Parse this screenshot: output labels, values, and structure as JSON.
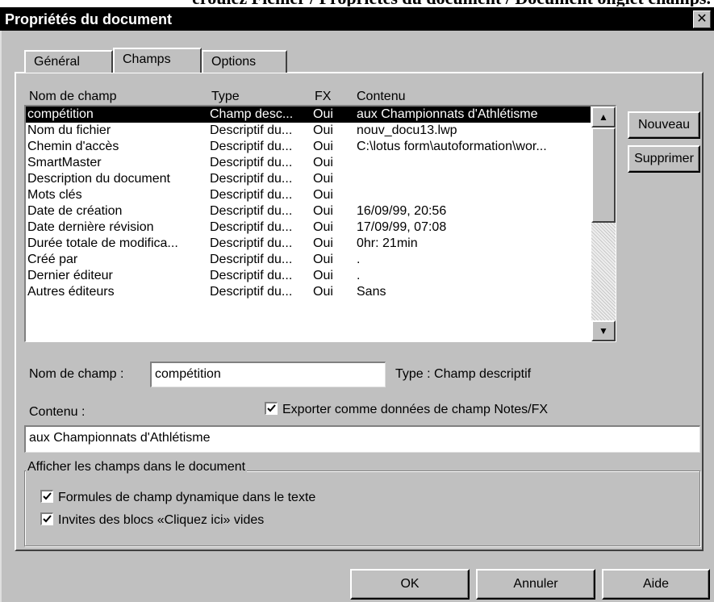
{
  "caption": "eroulez Fichier / Propriétés du document / Document onglet champs.",
  "dialog": {
    "title": "Propriétés du document",
    "close_glyph": "✕"
  },
  "tabs": [
    {
      "label": "Général",
      "active": false
    },
    {
      "label": "Champs",
      "active": true
    },
    {
      "label": "Options",
      "active": false
    }
  ],
  "list": {
    "headers": {
      "name": "Nom de champ",
      "type": "Type",
      "fx": "FX",
      "content": "Contenu"
    },
    "rows": [
      {
        "name": "compétition",
        "type": "Champ desc...",
        "fx": "Oui",
        "content": "aux Championnats d'Athlétisme",
        "selected": true
      },
      {
        "name": "Nom du fichier",
        "type": "Descriptif du...",
        "fx": "Oui",
        "content": "nouv_docu13.lwp"
      },
      {
        "name": "Chemin d'accès",
        "type": "Descriptif du...",
        "fx": "Oui",
        "content": "C:\\lotus form\\autoformation\\wor..."
      },
      {
        "name": "SmartMaster",
        "type": "Descriptif du...",
        "fx": "Oui",
        "content": ""
      },
      {
        "name": "Description du document",
        "type": "Descriptif du...",
        "fx": "Oui",
        "content": ""
      },
      {
        "name": "Mots clés",
        "type": "Descriptif du...",
        "fx": "Oui",
        "content": ""
      },
      {
        "name": "Date de création",
        "type": "Descriptif du...",
        "fx": "Oui",
        "content": "16/09/99, 20:56"
      },
      {
        "name": "Date dernière révision",
        "type": "Descriptif du...",
        "fx": "Oui",
        "content": "17/09/99, 07:08"
      },
      {
        "name": "Durée totale de modifica...",
        "type": "Descriptif du...",
        "fx": "Oui",
        "content": "0hr: 21min"
      },
      {
        "name": "Créé par",
        "type": "Descriptif du...",
        "fx": "Oui",
        "content": "."
      },
      {
        "name": "Dernier éditeur",
        "type": "Descriptif du...",
        "fx": "Oui",
        "content": "."
      },
      {
        "name": "Autres éditeurs",
        "type": "Descriptif du...",
        "fx": "Oui",
        "content": "Sans"
      }
    ]
  },
  "buttons": {
    "new": "Nouveau",
    "delete": "Supprimer",
    "ok": "OK",
    "cancel": "Annuler",
    "help": "Aide"
  },
  "field_name": {
    "label": "Nom de champ :",
    "value": "compétition",
    "type_label": "Type : Champ descriptif"
  },
  "content": {
    "label": "Contenu :",
    "value": "aux Championnats d'Athlétisme",
    "export_checkbox_label": "Exporter comme données de champ Notes/FX",
    "export_checked": true
  },
  "display_group": {
    "legend": "Afficher les champs dans le document",
    "options": [
      {
        "label": "Formules de champ dynamique dans le texte",
        "checked": true
      },
      {
        "label": "Invites des blocs «Cliquez ici» vides",
        "checked": true
      }
    ]
  }
}
